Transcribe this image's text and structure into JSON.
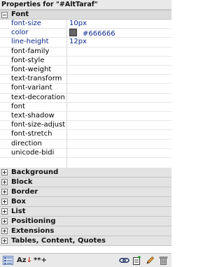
{
  "panel": {
    "title": "Properties for \"#AltTaraf\""
  },
  "font_category": {
    "label": "Font",
    "properties": [
      {
        "name": "font-size",
        "value": "10px",
        "set": true
      },
      {
        "name": "color",
        "value": "#666666",
        "set": true,
        "swatch": "#666666"
      },
      {
        "name": "line-height",
        "value": "12px",
        "set": true
      },
      {
        "name": "font-family",
        "value": ""
      },
      {
        "name": "font-style",
        "value": ""
      },
      {
        "name": "font-weight",
        "value": ""
      },
      {
        "name": "text-transform",
        "value": ""
      },
      {
        "name": "font-variant",
        "value": ""
      },
      {
        "name": "text-decoration",
        "value": ""
      },
      {
        "name": "font",
        "value": ""
      },
      {
        "name": "text-shadow",
        "value": ""
      },
      {
        "name": "font-size-adjust",
        "value": ""
      },
      {
        "name": "font-stretch",
        "value": ""
      },
      {
        "name": "direction",
        "value": ""
      },
      {
        "name": "unicode-bidi",
        "value": ""
      }
    ]
  },
  "categories": [
    {
      "label": "Background"
    },
    {
      "label": "Block"
    },
    {
      "label": "Border"
    },
    {
      "label": "Box"
    },
    {
      "label": "List"
    },
    {
      "label": "Positioning"
    },
    {
      "label": "Extensions"
    },
    {
      "label": "Tables, Content, Quotes"
    }
  ],
  "toolbar": {
    "sort_az_label": "Az",
    "show_set_label": "**+"
  },
  "icons": {
    "category_view": "category-view-icon",
    "sort_alpha": "sort-alpha-icon",
    "show_set": "show-set-properties-icon",
    "attach_style": "attach-style-sheet-icon",
    "new_rule": "new-css-rule-icon",
    "edit": "edit-pencil-icon",
    "delete": "trash-icon"
  }
}
